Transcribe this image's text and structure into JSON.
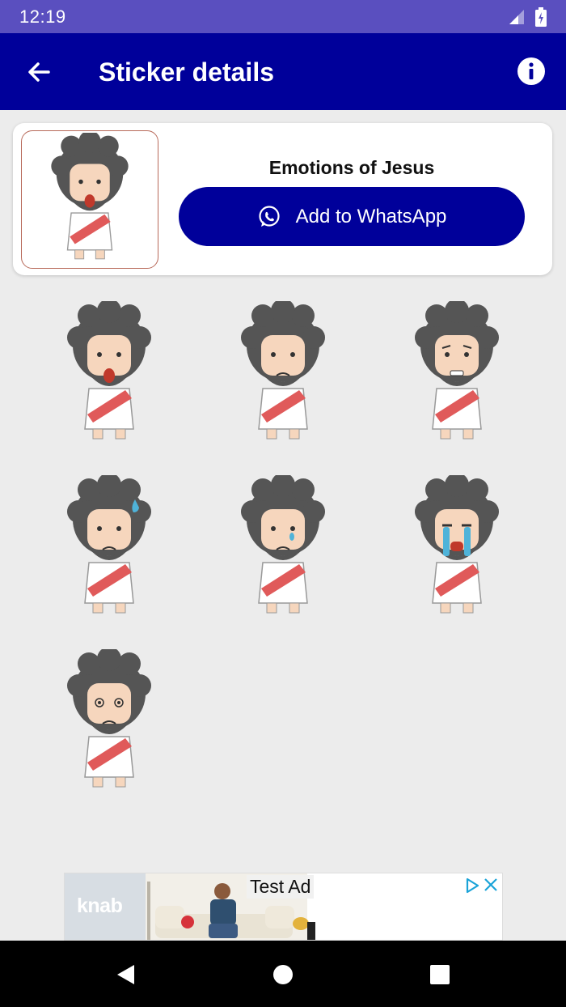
{
  "status_bar": {
    "time": "12:19"
  },
  "app_bar": {
    "title": "Sticker details"
  },
  "pack": {
    "name": "Emotions of Jesus",
    "add_button_label": "Add to WhatsApp"
  },
  "stickers": [
    {
      "expression": "shocked"
    },
    {
      "expression": "sad"
    },
    {
      "expression": "worried"
    },
    {
      "expression": "nervous-sweat"
    },
    {
      "expression": "teary"
    },
    {
      "expression": "crying"
    },
    {
      "expression": "dizzy"
    }
  ],
  "ad": {
    "label": "Test Ad",
    "brand": "knab"
  },
  "colors": {
    "app_bar": "#00009a",
    "status_bar": "#5a4fbf",
    "sash": "#e05a5a",
    "skin": "#f6d6bd",
    "hair": "#555555"
  }
}
